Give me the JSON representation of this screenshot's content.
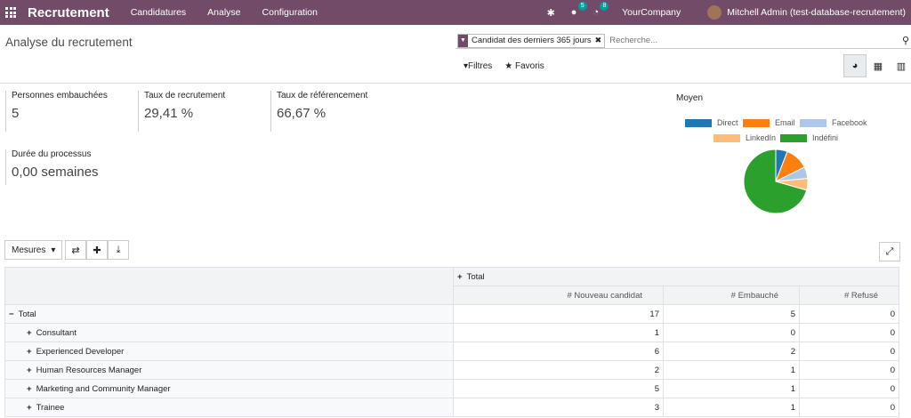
{
  "app": {
    "title": "Recrutement",
    "menu": [
      "Candidatures",
      "Analyse",
      "Configuration"
    ],
    "badges": {
      "messages": "5",
      "activities": "8"
    },
    "company": "YourCompany",
    "user": "Mitchell Admin (test-database-recrutement)"
  },
  "view": {
    "title": "Analyse du recrutement",
    "facet": "Candidat des derniers 365 jours",
    "search_placeholder": "Recherche...",
    "filters": "Filtres",
    "favorites": "Favoris"
  },
  "kpis": [
    {
      "label": "Personnes embauchées",
      "value": "5"
    },
    {
      "label": "Taux de recrutement",
      "value": "29,41 %"
    },
    {
      "label": "Taux de référencement",
      "value": "66,67 %"
    },
    {
      "label": "Durée du processus",
      "value": "0,00 semaines"
    }
  ],
  "chart_data": {
    "type": "pie",
    "title": "Moyen",
    "legend": [
      "Direct",
      "Email",
      "Facebook",
      "LinkedIn",
      "Indéfini"
    ],
    "colors": [
      "#1f77b4",
      "#ff7f0e",
      "#aec7e8",
      "#ffbb78",
      "#2ca02c"
    ],
    "values": [
      1,
      2,
      1,
      1,
      12
    ]
  },
  "pivot": {
    "measures_label": "Mesures",
    "col_header": "Total",
    "measures": [
      "# Nouveau candidat",
      "# Embauché",
      "# Refusé"
    ],
    "total_label": "Total",
    "total": [
      17,
      5,
      0
    ],
    "rows": [
      {
        "label": "Consultant",
        "values": [
          1,
          0,
          0
        ]
      },
      {
        "label": "Experienced Developer",
        "values": [
          6,
          2,
          0
        ]
      },
      {
        "label": "Human Resources Manager",
        "values": [
          2,
          1,
          0
        ]
      },
      {
        "label": "Marketing and Community Manager",
        "values": [
          5,
          1,
          0
        ]
      },
      {
        "label": "Trainee",
        "values": [
          3,
          1,
          0
        ]
      }
    ]
  }
}
